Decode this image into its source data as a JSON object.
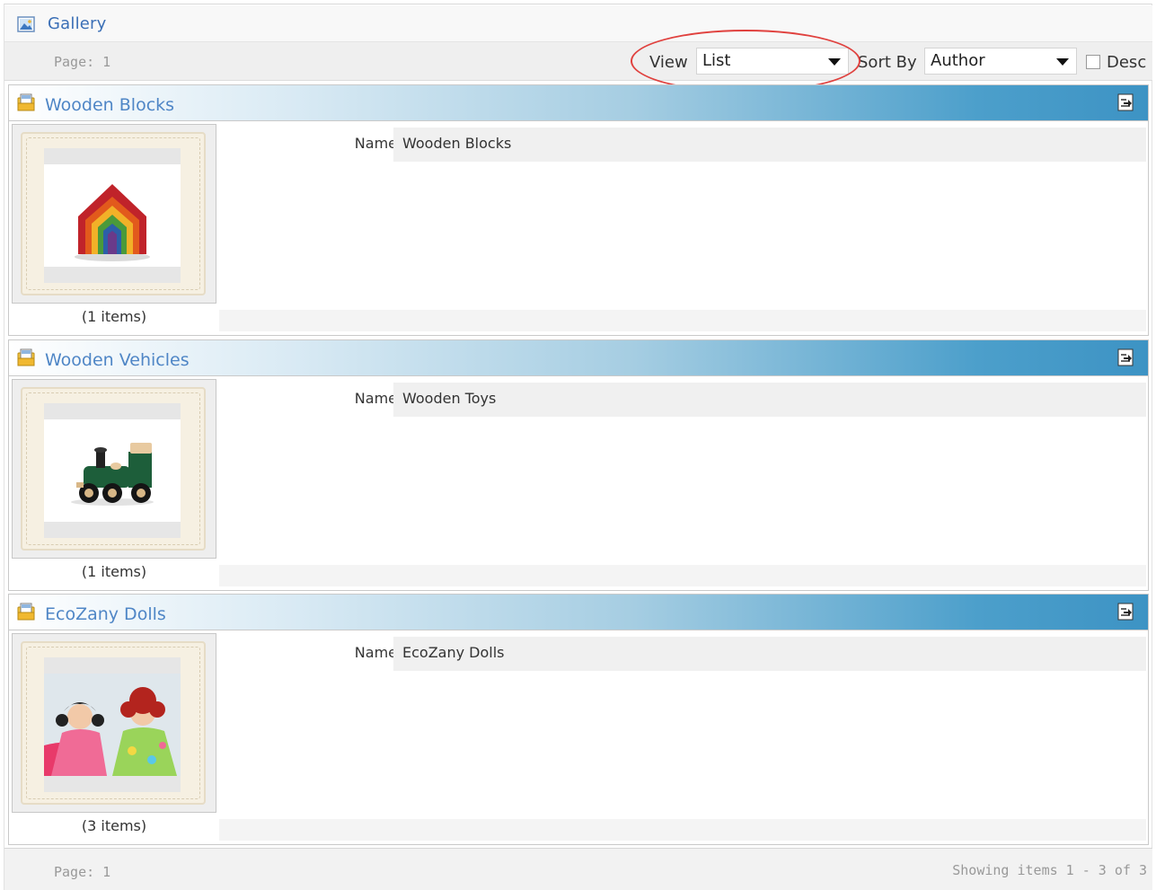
{
  "gallery": {
    "title": "Gallery"
  },
  "toolbar": {
    "page": "Page: 1",
    "view_label": "View",
    "view_value": "List",
    "sort_label": "Sort By",
    "sort_value": "Author",
    "desc_label": "Desc",
    "desc_checked": false
  },
  "albums": [
    {
      "title": "Wooden Blocks",
      "name_label": "Name",
      "name_value": "Wooden Blocks",
      "count": "(1 items)",
      "image": "rainbow-house-blocks"
    },
    {
      "title": "Wooden Vehicles",
      "name_label": "Name",
      "name_value": "Wooden Toys",
      "count": "(1 items)",
      "image": "wooden-train"
    },
    {
      "title": "EcoZany Dolls",
      "name_label": "Name",
      "name_value": "EcoZany Dolls",
      "count": "(3 items)",
      "image": "rag-dolls"
    }
  ],
  "footer": {
    "page": "Page: 1",
    "showing": "Showing items 1 - 3 of 3"
  },
  "colors": {
    "link": "#3b6fb6",
    "header_gradient_end": "#3d93c4",
    "annotation": "#e0413e"
  }
}
